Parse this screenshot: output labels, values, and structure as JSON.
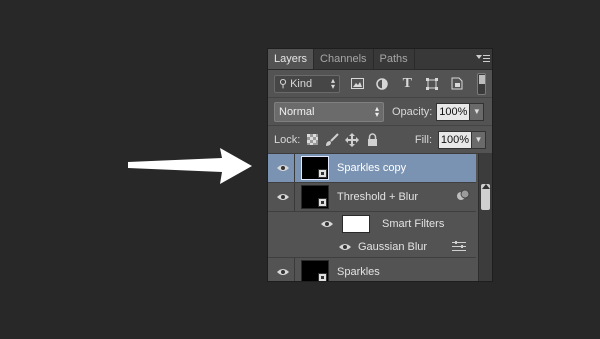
{
  "tabs": [
    {
      "label": "Layers",
      "active": true
    },
    {
      "label": "Channels",
      "active": false
    },
    {
      "label": "Paths",
      "active": false
    }
  ],
  "filter": {
    "kind_label": "Kind",
    "icons": [
      "image-filter-icon",
      "adjustment-filter-icon",
      "type-filter-icon",
      "shape-filter-icon",
      "smart-object-filter-icon"
    ]
  },
  "blend": {
    "mode": "Normal",
    "opacity_label": "Opacity:",
    "opacity_value": "100%"
  },
  "lock": {
    "label": "Lock:",
    "fill_label": "Fill:",
    "fill_value": "100%"
  },
  "layers": [
    {
      "name": "Sparkles copy",
      "selected": true
    },
    {
      "name": "Threshold + Blur",
      "selected": false
    },
    {
      "name": "Smart Filters",
      "selected": false
    },
    {
      "name": "Gaussian Blur",
      "selected": false
    },
    {
      "name": "Sparkles",
      "selected": false
    }
  ],
  "colors": {
    "selected_row": "#7a93b3",
    "panel_bg": "#535353",
    "page_bg": "#282828"
  }
}
